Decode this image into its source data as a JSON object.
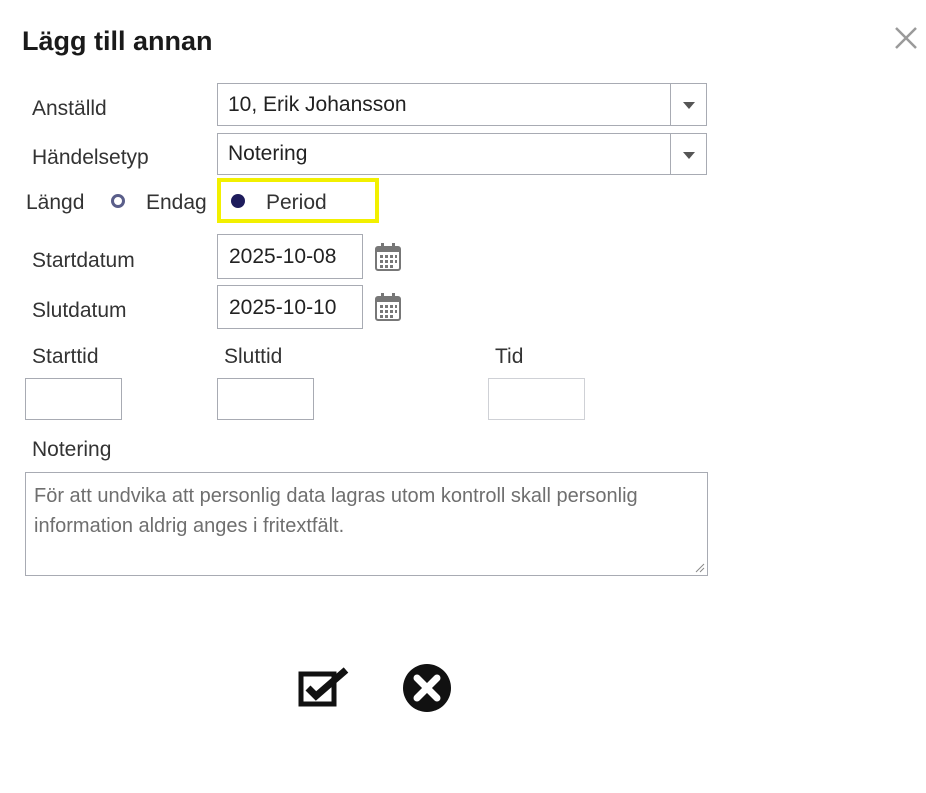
{
  "dialog": {
    "title": "Lägg till annan",
    "close_label": "×"
  },
  "fields": {
    "employee": {
      "label": "Anställd",
      "value": "10, Erik Johansson"
    },
    "event_type": {
      "label": "Händelsetyp",
      "value": "Notering"
    },
    "length": {
      "label": "Längd",
      "options": [
        {
          "label": "Endag",
          "selected": false
        },
        {
          "label": "Period",
          "selected": true
        }
      ]
    },
    "start_date": {
      "label": "Startdatum",
      "value": "2025-10-08"
    },
    "end_date": {
      "label": "Slutdatum",
      "value": "2025-10-10"
    },
    "start_time": {
      "label": "Starttid",
      "value": ""
    },
    "end_time": {
      "label": "Sluttid",
      "value": ""
    },
    "time": {
      "label": "Tid",
      "value": ""
    },
    "note": {
      "label": "Notering",
      "placeholder": "För att undvika att personlig data lagras utom kontroll skall personlig information aldrig anges i fritextfält."
    }
  },
  "colors": {
    "highlight": "#f2f000",
    "radio_selected": "#1e1c5c",
    "border": "#a8abb3"
  },
  "icons": {
    "confirm": "checkbox-check-icon",
    "cancel": "circle-x-icon",
    "calendar": "calendar-icon"
  }
}
